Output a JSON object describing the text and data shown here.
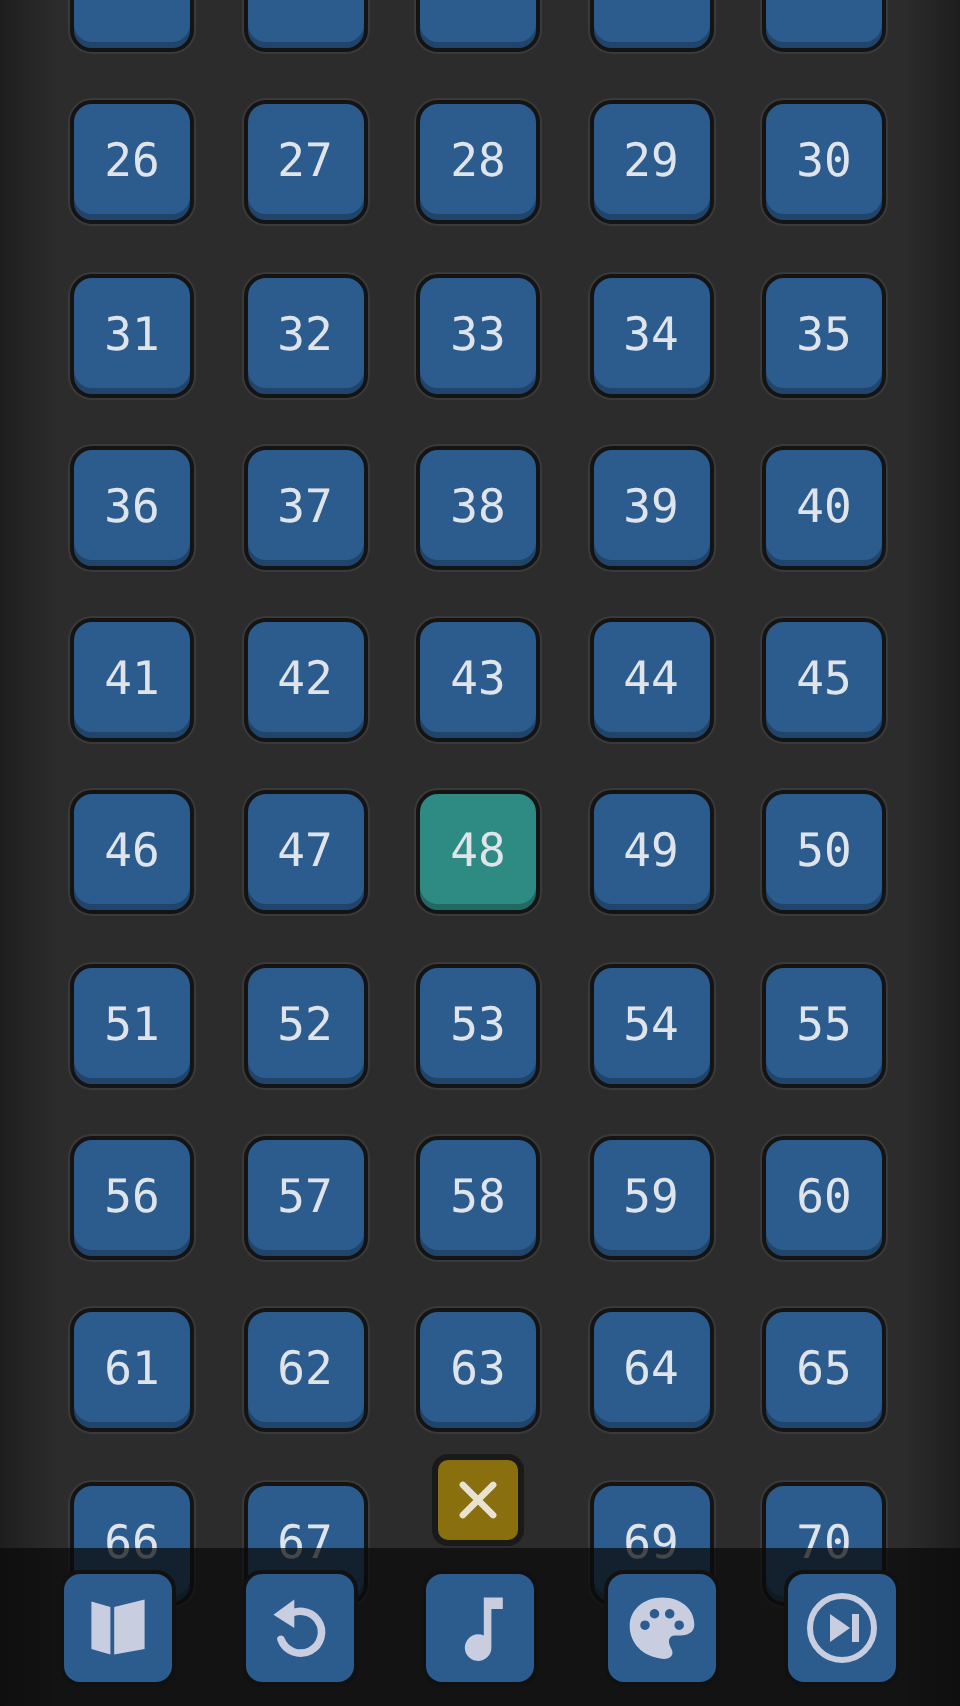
{
  "levels": [
    {
      "selected": false
    },
    {
      "selected": false
    },
    {
      "selected": false
    },
    {
      "selected": false
    },
    {
      "selected": false
    },
    {
      "label": "26",
      "selected": false
    },
    {
      "label": "27",
      "selected": false
    },
    {
      "label": "28",
      "selected": false
    },
    {
      "label": "29",
      "selected": false
    },
    {
      "label": "30",
      "selected": false
    },
    {
      "label": "31",
      "selected": false
    },
    {
      "label": "32",
      "selected": false
    },
    {
      "label": "33",
      "selected": false
    },
    {
      "label": "34",
      "selected": false
    },
    {
      "label": "35",
      "selected": false
    },
    {
      "label": "36",
      "selected": false
    },
    {
      "label": "37",
      "selected": false
    },
    {
      "label": "38",
      "selected": false
    },
    {
      "label": "39",
      "selected": false
    },
    {
      "label": "40",
      "selected": false
    },
    {
      "label": "41",
      "selected": false
    },
    {
      "label": "42",
      "selected": false
    },
    {
      "label": "43",
      "selected": false
    },
    {
      "label": "44",
      "selected": false
    },
    {
      "label": "45",
      "selected": false
    },
    {
      "label": "46",
      "selected": false
    },
    {
      "label": "47",
      "selected": false
    },
    {
      "label": "48",
      "selected": true
    },
    {
      "label": "49",
      "selected": false
    },
    {
      "label": "50",
      "selected": false
    },
    {
      "label": "51",
      "selected": false
    },
    {
      "label": "52",
      "selected": false
    },
    {
      "label": "53",
      "selected": false
    },
    {
      "label": "54",
      "selected": false
    },
    {
      "label": "55",
      "selected": false
    },
    {
      "label": "56",
      "selected": false
    },
    {
      "label": "57",
      "selected": false
    },
    {
      "label": "58",
      "selected": false
    },
    {
      "label": "59",
      "selected": false
    },
    {
      "label": "60",
      "selected": false
    },
    {
      "label": "61",
      "selected": false
    },
    {
      "label": "62",
      "selected": false
    },
    {
      "label": "63",
      "selected": false
    },
    {
      "label": "64",
      "selected": false
    },
    {
      "label": "65",
      "selected": false
    },
    {
      "label": "66",
      "selected": false
    },
    {
      "label": "67",
      "selected": false
    },
    {
      "kind": "close"
    },
    {
      "label": "69",
      "selected": false
    },
    {
      "label": "70",
      "selected": false
    }
  ]
}
